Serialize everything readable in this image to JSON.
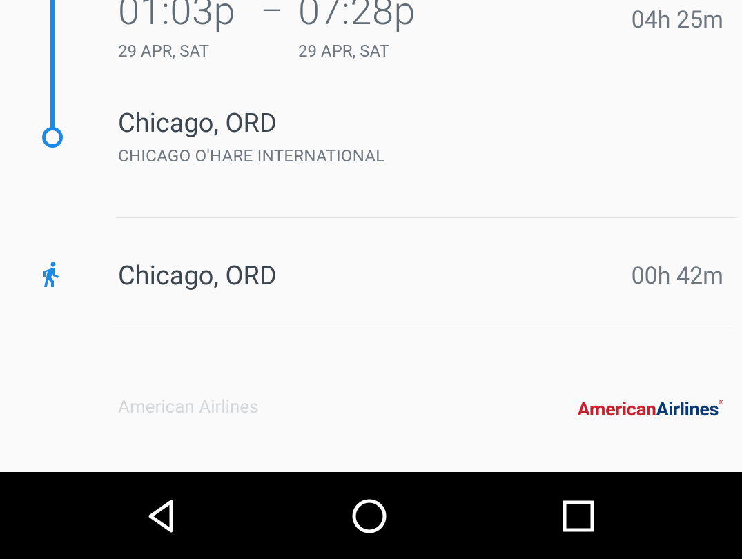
{
  "flight": {
    "depart_time": "01:03p",
    "separator": "–",
    "arrive_time": "07:28p",
    "depart_date": "29 APR, SAT",
    "arrive_date": "29 APR, SAT",
    "duration": "04h 25m",
    "arrival_city": "Chicago, ORD",
    "arrival_airport": "CHICAGO O'HARE INTERNATIONAL"
  },
  "layover": {
    "icon": "walk-icon",
    "city": "Chicago, ORD",
    "duration": "00h 42m"
  },
  "airline": {
    "name": "American Airlines",
    "logo_part1": "American",
    "logo_part2": "Airlines",
    "logo_reg": "®"
  },
  "colors": {
    "accent": "#1e88e5",
    "logo_red": "#c8202f",
    "logo_blue": "#0a3a73"
  },
  "navbar": {
    "icons": [
      "back-icon",
      "home-icon",
      "recents-icon"
    ]
  }
}
